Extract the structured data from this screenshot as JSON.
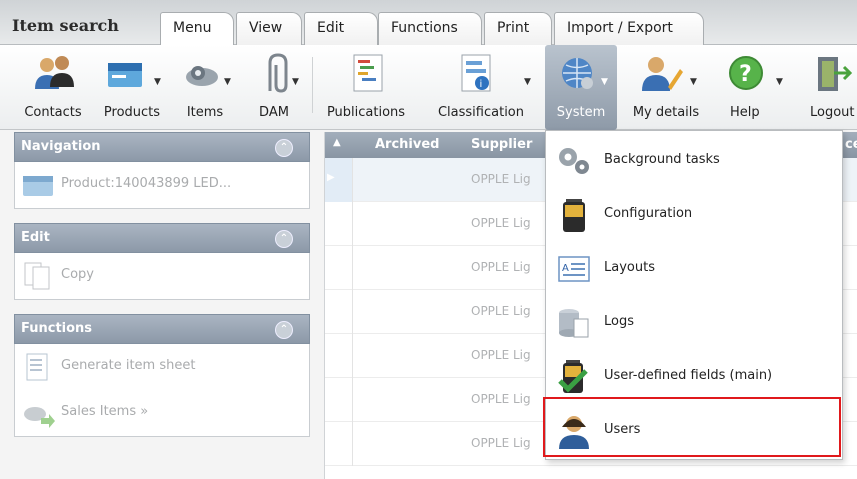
{
  "app": {
    "title": "Item search"
  },
  "tabs": [
    {
      "label": "Menu",
      "active": true
    },
    {
      "label": "View"
    },
    {
      "label": "Edit"
    },
    {
      "label": "Functions"
    },
    {
      "label": "Print"
    },
    {
      "label": "Import / Export"
    }
  ],
  "ribbon": [
    {
      "label": "Contacts",
      "icon": "contacts-icon"
    },
    {
      "label": "Products",
      "icon": "products-icon"
    },
    {
      "label": "Items",
      "icon": "items-icon"
    },
    {
      "label": "DAM",
      "icon": "paperclip-icon"
    },
    {
      "label": "Publications",
      "icon": "publications-icon"
    },
    {
      "label": "Classification",
      "icon": "classification-icon"
    },
    {
      "label": "System",
      "icon": "globe-icon",
      "active": true
    },
    {
      "label": "My details",
      "icon": "user-edit-icon"
    },
    {
      "label": "Help",
      "icon": "help-icon"
    },
    {
      "label": "Logout",
      "icon": "logout-icon"
    }
  ],
  "sidebar": {
    "navigation": {
      "title": "Navigation",
      "items": [
        "Product:140043899 LED..."
      ]
    },
    "edit": {
      "title": "Edit",
      "items": [
        "Copy"
      ]
    },
    "functions": {
      "title": "Functions",
      "items": [
        "Generate item sheet",
        "Sales Items »"
      ]
    }
  },
  "grid": {
    "columns": [
      "Archived",
      "Supplier"
    ],
    "truncated_col": "ce",
    "rows": [
      "OPPLE Lig",
      "OPPLE Lig",
      "OPPLE Lig",
      "OPPLE Lig",
      "OPPLE Lig",
      "OPPLE Lig",
      "OPPLE Lig"
    ]
  },
  "system_menu": [
    {
      "label": "Background tasks",
      "icon": "gears-icon"
    },
    {
      "label": "Configuration",
      "icon": "battery-icon"
    },
    {
      "label": "Layouts",
      "icon": "layout-icon"
    },
    {
      "label": "Logs",
      "icon": "logs-icon"
    },
    {
      "label": "User-defined fields (main)",
      "icon": "checked-battery-icon"
    },
    {
      "label": "Users",
      "icon": "users-icon",
      "highlighted": true
    }
  ],
  "colors": {
    "highlight": "#e0191c",
    "panel_header": "#8c99a8",
    "active_tab": "#ffffff"
  }
}
